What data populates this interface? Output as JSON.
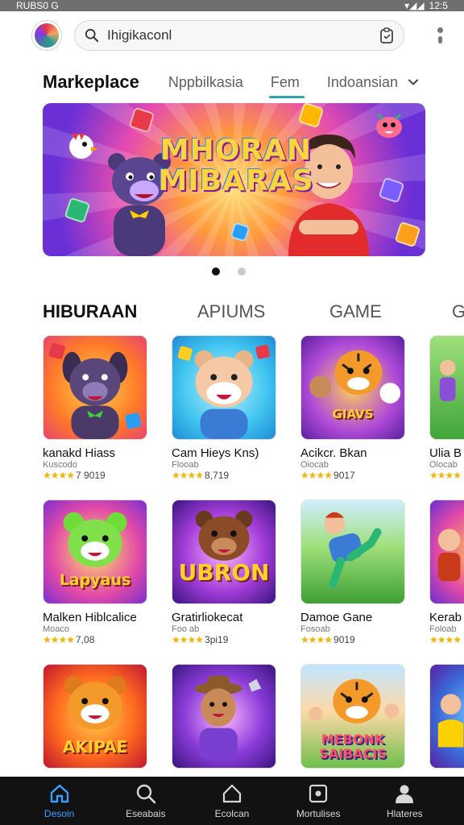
{
  "status_bar": {
    "left": "RUBS0 G",
    "right": "12:5"
  },
  "search": {
    "value": "Ihigikaconl",
    "placeholder": ""
  },
  "category_tabs": {
    "title": "Markeplace",
    "tabs": [
      {
        "label": "Nppbilkasia",
        "active": false
      },
      {
        "label": "Fem",
        "active": true
      },
      {
        "label": "Indoansian",
        "active": false
      }
    ]
  },
  "banner": {
    "title_line1": "MHORAN",
    "title_line2": "MIBARAS",
    "page": 1,
    "page_count": 2
  },
  "section_tabs": [
    {
      "label": "HIBURAAN",
      "active": true
    },
    {
      "label": "APIUMS",
      "active": false
    },
    {
      "label": "GAME",
      "active": false
    },
    {
      "label": "G",
      "active": false
    }
  ],
  "apps": [
    {
      "name": "kanakd Hiass",
      "sub": "Kuscodo",
      "stars": "★★★★",
      "rating": "7 9019",
      "art_text": ""
    },
    {
      "name": "Cam Hieys Kns)",
      "sub": "Flooab",
      "stars": "★★★★",
      "rating": "8,719",
      "art_text": ""
    },
    {
      "name": "Acikcr. Bkan",
      "sub": "Oiocab",
      "stars": "★★★★",
      "rating": "9017",
      "art_text": "GIAVS"
    },
    {
      "name": "Ulia B",
      "sub": "Olocab",
      "stars": "★★★★",
      "rating": "",
      "art_text": ""
    },
    {
      "name": "Malken Hiblcalice",
      "sub": "Moaco",
      "stars": "★★★★",
      "rating": "7,08",
      "art_text": "Lapyaus"
    },
    {
      "name": "Gratirliokecat",
      "sub": "Foo ab",
      "stars": "★★★★",
      "rating": "3pi19",
      "art_text": "UBRON"
    },
    {
      "name": "Damoe Gane",
      "sub": "Fosoab",
      "stars": "★★★★",
      "rating": "9019",
      "art_text": ""
    },
    {
      "name": "Kerab",
      "sub": "Foloab",
      "stars": "★★★★",
      "rating": "",
      "art_text": ""
    },
    {
      "name": "",
      "sub": "",
      "stars": "",
      "rating": "",
      "art_text": "AKIPAE"
    },
    {
      "name": "",
      "sub": "",
      "stars": "",
      "rating": "",
      "art_text": ""
    },
    {
      "name": "",
      "sub": "",
      "stars": "",
      "rating": "",
      "art_text": "MEBONK SAIBACIS"
    },
    {
      "name": "",
      "sub": "",
      "stars": "",
      "rating": "",
      "art_text": ""
    }
  ],
  "bottom_nav": [
    {
      "label": "Desoin",
      "icon": "home-icon",
      "active": true
    },
    {
      "label": "Eseabais",
      "icon": "search-icon",
      "active": false
    },
    {
      "label": "Ecolcan",
      "icon": "house-outline-icon",
      "active": false
    },
    {
      "label": "Mortulises",
      "icon": "library-icon",
      "active": false
    },
    {
      "label": "Hlateres",
      "icon": "profile-icon",
      "active": false
    }
  ],
  "colors": {
    "accent": "#2aa7b5",
    "nav_active": "#3aa0ff",
    "nav_bg": "#121212",
    "star": "#f2b400"
  }
}
